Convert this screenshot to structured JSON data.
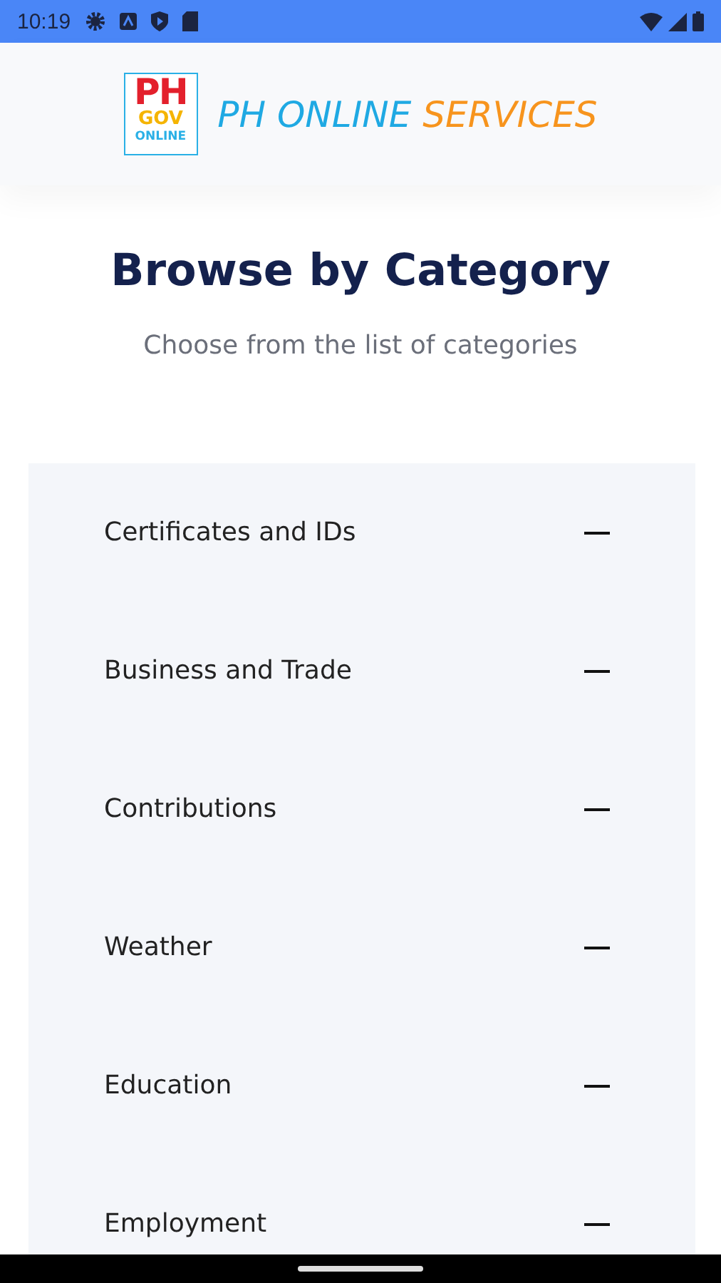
{
  "status_bar": {
    "time": "10:19"
  },
  "header": {
    "logo": {
      "line_1": "PH",
      "line_2": "GOV",
      "line_3": "ONLINE"
    },
    "brand_part_1": "PH ONLINE",
    "brand_part_2": "SERVICES"
  },
  "title": "Browse by Category",
  "subtitle": "Choose from the list of categories",
  "categories": [
    {
      "label": "Certificates and IDs",
      "expanded": true
    },
    {
      "label": "Business and Trade",
      "expanded": true
    },
    {
      "label": "Contributions",
      "expanded": true
    },
    {
      "label": "Weather",
      "expanded": true
    },
    {
      "label": "Education",
      "expanded": true
    },
    {
      "label": "Employment",
      "expanded": true
    }
  ]
}
